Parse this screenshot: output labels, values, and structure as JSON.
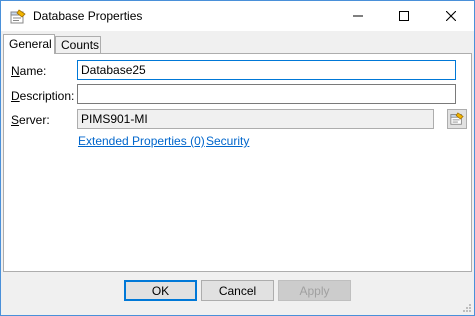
{
  "window": {
    "title": "Database Properties",
    "icon": "database-properties-icon"
  },
  "tabs": [
    {
      "label": "General",
      "active": true
    },
    {
      "label": "Counts",
      "active": false
    }
  ],
  "general": {
    "name_label_mnemonic": "N",
    "name_label_rest": "ame:",
    "name_value": "Database25",
    "description_label_mnemonic": "D",
    "description_label_rest": "escription:",
    "description_value": "",
    "server_label_mnemonic": "S",
    "server_label_rest": "erver:",
    "server_value": "PIMS901-MI",
    "extended_properties_link": "Extended Properties (0)",
    "security_link": "Security"
  },
  "buttons": {
    "ok": "OK",
    "cancel": "Cancel",
    "apply": "Apply"
  },
  "colors": {
    "accent": "#0078d7",
    "link": "#0066cc",
    "window_border": "#4a90d9"
  }
}
